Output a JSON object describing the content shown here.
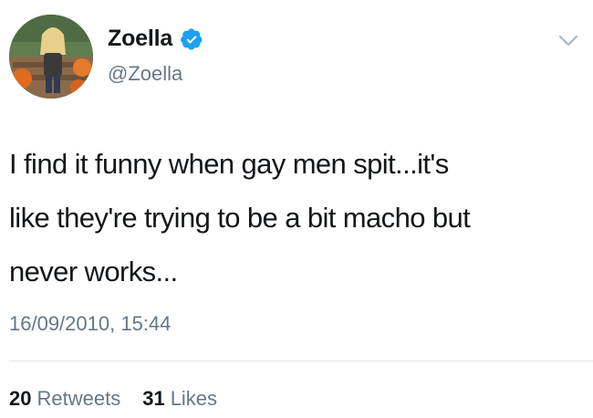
{
  "user": {
    "display_name": "Zoella",
    "handle": "@Zoella",
    "verified": true
  },
  "tweet": {
    "lines": [
      "I find it funny when gay men spit...it's",
      "like they're trying to be a bit macho but",
      "never works..."
    ],
    "timestamp": "16/09/2010, 15:44"
  },
  "stats": {
    "retweets_count": "20",
    "retweets_label": "Retweets",
    "likes_count": "31",
    "likes_label": "Likes"
  },
  "icons": {
    "verified": "verified-badge-icon",
    "menu": "chevron-down-icon"
  },
  "colors": {
    "verified_blue": "#1da1f2",
    "secondary_text": "#657786",
    "primary_text": "#14171a"
  }
}
